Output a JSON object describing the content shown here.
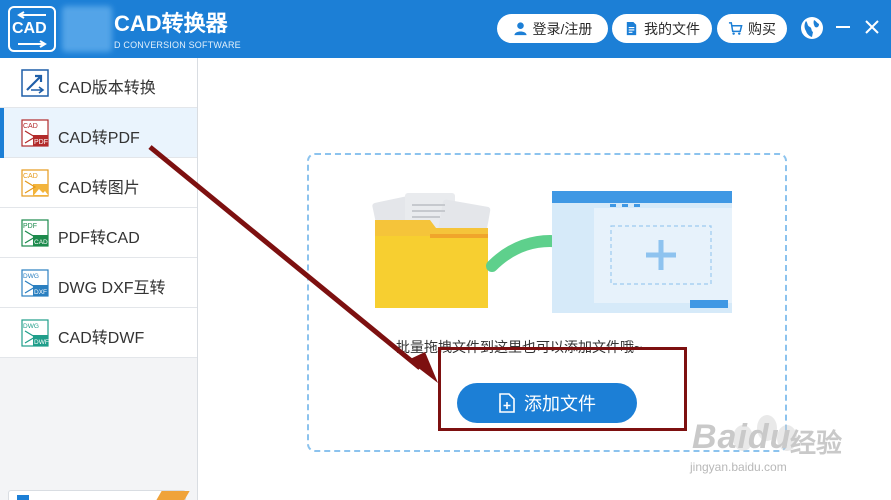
{
  "header": {
    "logo_text": "CAD",
    "title": "CAD转换器",
    "subtitle": "D CONVERSION SOFTWARE",
    "login_label": "登录/注册",
    "my_files_label": "我的文件",
    "buy_label": "购买",
    "accent_color": "#1c7fd6"
  },
  "sidebar": {
    "items": [
      {
        "label": "CAD版本转换",
        "icon": "cad-version-convert-icon"
      },
      {
        "label": "CAD转PDF",
        "icon": "cad-to-pdf-icon",
        "active": true
      },
      {
        "label": "CAD转图片",
        "icon": "cad-to-image-icon"
      },
      {
        "label": "PDF转CAD",
        "icon": "pdf-to-cad-icon"
      },
      {
        "label": "DWG DXF互转",
        "icon": "dwg-dxf-convert-icon"
      },
      {
        "label": "CAD转DWF",
        "icon": "cad-to-dwf-icon"
      }
    ],
    "icon_texts": {
      "cad": "CAD",
      "pdf": "PDF",
      "dwg": "DWG",
      "dxf": "DXF",
      "dwf": "DWF"
    }
  },
  "main": {
    "drop_hint": "批量拖拽文件到这里也可以添加文件哦~",
    "add_file_label": "添加文件"
  },
  "watermark": {
    "brand": "Baidu",
    "brand_cn": "经验",
    "url": "jingyan.baidu.com"
  },
  "annotation_color": "#7d1010"
}
